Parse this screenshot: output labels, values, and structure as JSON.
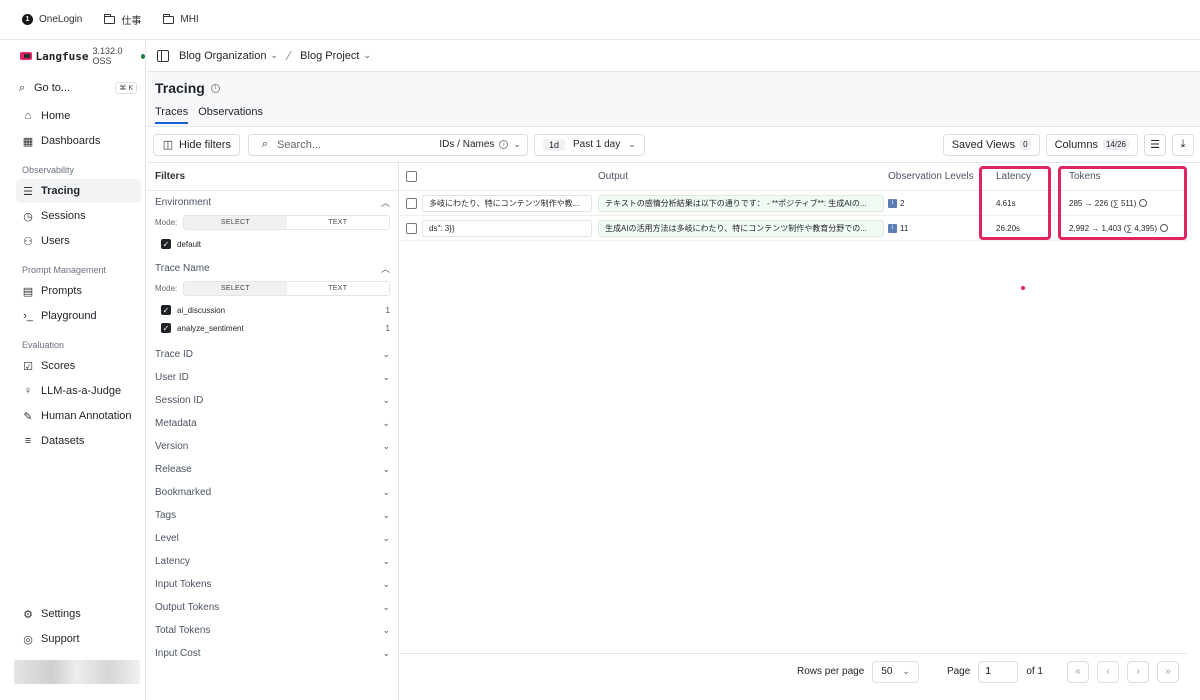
{
  "bookmarks": [
    {
      "label": "OneLogin",
      "icon": "onelogin-icon"
    },
    {
      "label": "仕事",
      "icon": "folder-icon"
    },
    {
      "label": "MHI",
      "icon": "folder-icon"
    }
  ],
  "brand": {
    "name": "Langfuse",
    "version": "3.132.0 OSS"
  },
  "goto": {
    "label": "Go to...",
    "shortcut": "⌘ K"
  },
  "nav": {
    "home": "Home",
    "dashboards": "Dashboards",
    "section_observability": "Observability",
    "tracing": "Tracing",
    "sessions": "Sessions",
    "users": "Users",
    "section_prompt": "Prompt Management",
    "prompts": "Prompts",
    "playground": "Playground",
    "section_eval": "Evaluation",
    "scores": "Scores",
    "llm_judge": "LLM-as-a-Judge",
    "human_annotation": "Human Annotation",
    "datasets": "Datasets",
    "settings": "Settings",
    "support": "Support"
  },
  "breadcrumb": {
    "org": "Blog Organization",
    "project": "Blog Project"
  },
  "page": {
    "title": "Tracing",
    "tabs": [
      "Traces",
      "Observations"
    ]
  },
  "toolbar": {
    "hide_filters": "Hide filters",
    "search_placeholder": "Search...",
    "ids_names": "IDs / Names",
    "range_short": "1d",
    "range_label": "Past 1 day",
    "saved_views": "Saved Views",
    "saved_views_count": "0",
    "columns": "Columns",
    "columns_count": "14/26"
  },
  "filters": {
    "title": "Filters",
    "environment": {
      "label": "Environment",
      "mode_label": "Mode:",
      "mode_select": "SELECT",
      "mode_text": "TEXT",
      "values": [
        {
          "label": "default"
        }
      ]
    },
    "trace_name": {
      "label": "Trace Name",
      "mode_label": "Mode:",
      "mode_select": "SELECT",
      "mode_text": "TEXT",
      "values": [
        {
          "label": "ai_discussion",
          "count": "1"
        },
        {
          "label": "analyze_sentiment",
          "count": "1"
        }
      ]
    },
    "collapsed": [
      "Trace ID",
      "User ID",
      "Session ID",
      "Metadata",
      "Version",
      "Release",
      "Bookmarked",
      "Tags",
      "Level",
      "Latency",
      "Input Tokens",
      "Output Tokens",
      "Total Tokens",
      "Input Cost"
    ]
  },
  "table": {
    "headers": {
      "output": "Output",
      "levels": "Observation Levels",
      "latency": "Latency",
      "tokens": "Tokens"
    },
    "rows": [
      {
        "input": "多岐にわたり、特にコンテンツ制作や教...",
        "output": "テキストの感情分析結果は以下の通りです： - **ポジティブ**: 生成AIの...",
        "levels": "2",
        "latency": "4.61s",
        "tokens": "285 → 226 (∑ 511)"
      },
      {
        "input": "ds\": 3}}",
        "output": "生成AIの活用方法は多岐にわたり、特にコンテンツ制作や教育分野での...",
        "levels": "11",
        "latency": "26.20s",
        "tokens": "2,992 → 1,403 (∑ 4,395)"
      }
    ]
  },
  "footer": {
    "rows_per_page_label": "Rows per page",
    "rows_per_page": "50",
    "page_label": "Page",
    "page_value": "1",
    "of_label": "of 1"
  },
  "colors": {
    "accent": "#1f5fd6",
    "highlight": "#e0245e",
    "brand": "#e0245e"
  }
}
